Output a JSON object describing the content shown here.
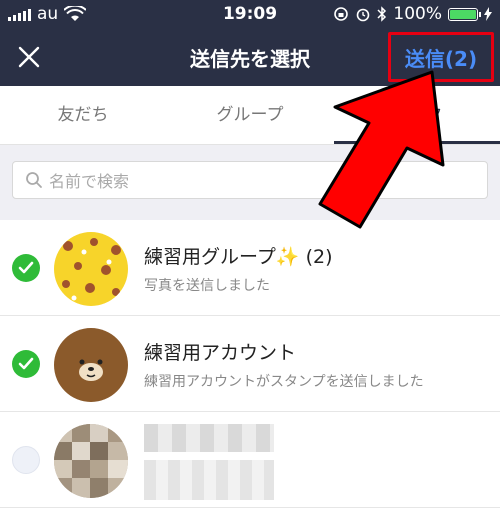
{
  "status_bar": {
    "carrier": "au",
    "time": "19:09",
    "battery": "100%",
    "battery_level": 1.0
  },
  "navbar": {
    "close_icon": "close-icon",
    "title": "送信先を選択",
    "send_label": "送信(2)"
  },
  "tabs": [
    {
      "label": "友だち"
    },
    {
      "label": "グループ"
    },
    {
      "label": "トーク"
    }
  ],
  "search": {
    "placeholder": "名前で検索"
  },
  "list": [
    {
      "name": "練習用グループ✨",
      "count": "(2)",
      "subtitle": "写真を送信しました",
      "checked": true
    },
    {
      "name": "練習用アカウント",
      "count": "",
      "subtitle": "練習用アカウントがスタンプを送信しました",
      "checked": true
    },
    {
      "name": "",
      "count": "",
      "subtitle": "",
      "checked": false
    }
  ],
  "colors": {
    "header_bg": "#2a3045",
    "send_text": "#4a8cf7",
    "check_on": "#2fbb38",
    "arrow": "#ff0000"
  }
}
